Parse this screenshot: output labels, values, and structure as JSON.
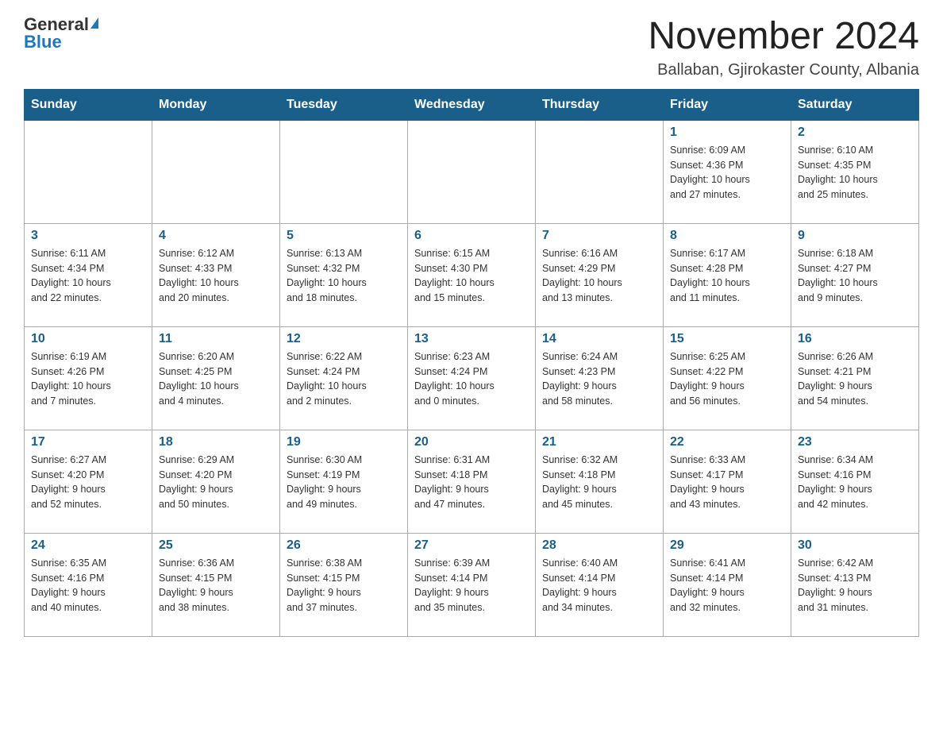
{
  "logo": {
    "general": "General",
    "blue": "Blue"
  },
  "title": "November 2024",
  "subtitle": "Ballaban, Gjirokaster County, Albania",
  "days_of_week": [
    "Sunday",
    "Monday",
    "Tuesday",
    "Wednesday",
    "Thursday",
    "Friday",
    "Saturday"
  ],
  "weeks": [
    [
      {
        "day": "",
        "info": ""
      },
      {
        "day": "",
        "info": ""
      },
      {
        "day": "",
        "info": ""
      },
      {
        "day": "",
        "info": ""
      },
      {
        "day": "",
        "info": ""
      },
      {
        "day": "1",
        "info": "Sunrise: 6:09 AM\nSunset: 4:36 PM\nDaylight: 10 hours\nand 27 minutes."
      },
      {
        "day": "2",
        "info": "Sunrise: 6:10 AM\nSunset: 4:35 PM\nDaylight: 10 hours\nand 25 minutes."
      }
    ],
    [
      {
        "day": "3",
        "info": "Sunrise: 6:11 AM\nSunset: 4:34 PM\nDaylight: 10 hours\nand 22 minutes."
      },
      {
        "day": "4",
        "info": "Sunrise: 6:12 AM\nSunset: 4:33 PM\nDaylight: 10 hours\nand 20 minutes."
      },
      {
        "day": "5",
        "info": "Sunrise: 6:13 AM\nSunset: 4:32 PM\nDaylight: 10 hours\nand 18 minutes."
      },
      {
        "day": "6",
        "info": "Sunrise: 6:15 AM\nSunset: 4:30 PM\nDaylight: 10 hours\nand 15 minutes."
      },
      {
        "day": "7",
        "info": "Sunrise: 6:16 AM\nSunset: 4:29 PM\nDaylight: 10 hours\nand 13 minutes."
      },
      {
        "day": "8",
        "info": "Sunrise: 6:17 AM\nSunset: 4:28 PM\nDaylight: 10 hours\nand 11 minutes."
      },
      {
        "day": "9",
        "info": "Sunrise: 6:18 AM\nSunset: 4:27 PM\nDaylight: 10 hours\nand 9 minutes."
      }
    ],
    [
      {
        "day": "10",
        "info": "Sunrise: 6:19 AM\nSunset: 4:26 PM\nDaylight: 10 hours\nand 7 minutes."
      },
      {
        "day": "11",
        "info": "Sunrise: 6:20 AM\nSunset: 4:25 PM\nDaylight: 10 hours\nand 4 minutes."
      },
      {
        "day": "12",
        "info": "Sunrise: 6:22 AM\nSunset: 4:24 PM\nDaylight: 10 hours\nand 2 minutes."
      },
      {
        "day": "13",
        "info": "Sunrise: 6:23 AM\nSunset: 4:24 PM\nDaylight: 10 hours\nand 0 minutes."
      },
      {
        "day": "14",
        "info": "Sunrise: 6:24 AM\nSunset: 4:23 PM\nDaylight: 9 hours\nand 58 minutes."
      },
      {
        "day": "15",
        "info": "Sunrise: 6:25 AM\nSunset: 4:22 PM\nDaylight: 9 hours\nand 56 minutes."
      },
      {
        "day": "16",
        "info": "Sunrise: 6:26 AM\nSunset: 4:21 PM\nDaylight: 9 hours\nand 54 minutes."
      }
    ],
    [
      {
        "day": "17",
        "info": "Sunrise: 6:27 AM\nSunset: 4:20 PM\nDaylight: 9 hours\nand 52 minutes."
      },
      {
        "day": "18",
        "info": "Sunrise: 6:29 AM\nSunset: 4:20 PM\nDaylight: 9 hours\nand 50 minutes."
      },
      {
        "day": "19",
        "info": "Sunrise: 6:30 AM\nSunset: 4:19 PM\nDaylight: 9 hours\nand 49 minutes."
      },
      {
        "day": "20",
        "info": "Sunrise: 6:31 AM\nSunset: 4:18 PM\nDaylight: 9 hours\nand 47 minutes."
      },
      {
        "day": "21",
        "info": "Sunrise: 6:32 AM\nSunset: 4:18 PM\nDaylight: 9 hours\nand 45 minutes."
      },
      {
        "day": "22",
        "info": "Sunrise: 6:33 AM\nSunset: 4:17 PM\nDaylight: 9 hours\nand 43 minutes."
      },
      {
        "day": "23",
        "info": "Sunrise: 6:34 AM\nSunset: 4:16 PM\nDaylight: 9 hours\nand 42 minutes."
      }
    ],
    [
      {
        "day": "24",
        "info": "Sunrise: 6:35 AM\nSunset: 4:16 PM\nDaylight: 9 hours\nand 40 minutes."
      },
      {
        "day": "25",
        "info": "Sunrise: 6:36 AM\nSunset: 4:15 PM\nDaylight: 9 hours\nand 38 minutes."
      },
      {
        "day": "26",
        "info": "Sunrise: 6:38 AM\nSunset: 4:15 PM\nDaylight: 9 hours\nand 37 minutes."
      },
      {
        "day": "27",
        "info": "Sunrise: 6:39 AM\nSunset: 4:14 PM\nDaylight: 9 hours\nand 35 minutes."
      },
      {
        "day": "28",
        "info": "Sunrise: 6:40 AM\nSunset: 4:14 PM\nDaylight: 9 hours\nand 34 minutes."
      },
      {
        "day": "29",
        "info": "Sunrise: 6:41 AM\nSunset: 4:14 PM\nDaylight: 9 hours\nand 32 minutes."
      },
      {
        "day": "30",
        "info": "Sunrise: 6:42 AM\nSunset: 4:13 PM\nDaylight: 9 hours\nand 31 minutes."
      }
    ]
  ]
}
